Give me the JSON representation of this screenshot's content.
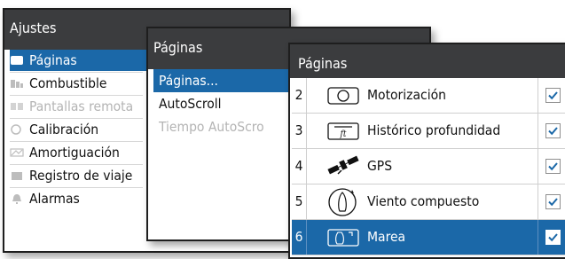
{
  "ajustes": {
    "title": "Ajustes",
    "items": [
      {
        "label": "Páginas",
        "icon": "pages-icon",
        "selected": true
      },
      {
        "label": "Combustible",
        "icon": "fuel-icon"
      },
      {
        "label": "Pantallas remota",
        "icon": "remote-displays-icon",
        "disabled": true
      },
      {
        "label": "Calibración",
        "icon": "calibration-icon"
      },
      {
        "label": "Amortiguación",
        "icon": "damping-icon"
      },
      {
        "label": "Registro de viaje",
        "icon": "trip-log-icon"
      },
      {
        "label": "Alarmas",
        "icon": "alarm-icon"
      }
    ]
  },
  "paginas_menu": {
    "title": "Páginas",
    "items": [
      {
        "label": "Páginas...",
        "selected": true
      },
      {
        "label": "AutoScroll"
      },
      {
        "label": "Tiempo AutoScro",
        "disabled": true
      }
    ]
  },
  "paginas_list": {
    "title": "Páginas",
    "rows": [
      {
        "num": "2",
        "label": "Motorización",
        "icon": "gauge-icon",
        "checked": true
      },
      {
        "num": "3",
        "label": "Histórico profundidad",
        "icon": "depth-history-icon",
        "checked": true
      },
      {
        "num": "4",
        "label": "GPS",
        "icon": "satellite-icon",
        "checked": true
      },
      {
        "num": "5",
        "label": "Viento compuesto",
        "icon": "boat-wind-icon",
        "checked": true
      },
      {
        "num": "6",
        "label": "Marea",
        "icon": "tide-icon",
        "checked": true,
        "selected": true
      }
    ]
  },
  "colors": {
    "accent": "#1b68a8",
    "header": "#3b3c3e",
    "check": "#1b68a8"
  }
}
